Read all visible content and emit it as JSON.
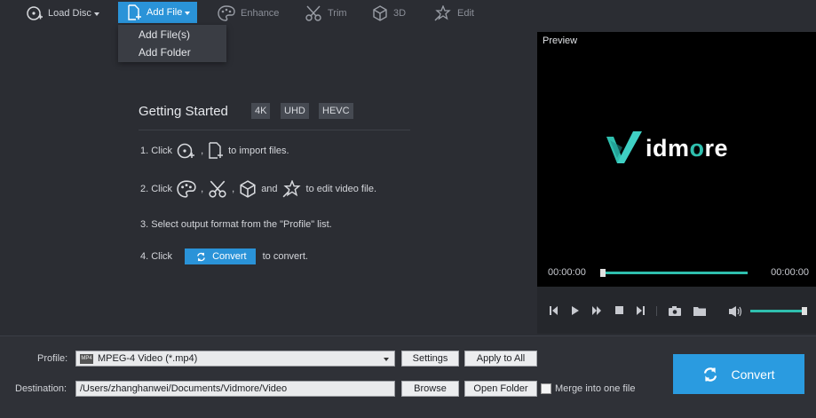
{
  "toolbar": {
    "load_disc": "Load Disc",
    "add_file": "Add File",
    "enhance": "Enhance",
    "trim": "Trim",
    "three_d": "3D",
    "edit": "Edit"
  },
  "dropdown": {
    "items": [
      "Add File(s)",
      "Add Folder"
    ]
  },
  "getting_started": {
    "title": "Getting Started",
    "badges": [
      "4K",
      "UHD",
      "HEVC"
    ],
    "step1_prefix": "1. Click",
    "step1_suffix": "to import files.",
    "step2_prefix": "2. Click",
    "step2_and": "and",
    "step2_suffix": "to edit video file.",
    "step3": "3. Select output format from the \"Profile\" list.",
    "step4_prefix": "4. Click",
    "step4_button": "Convert",
    "step4_suffix": "to convert."
  },
  "preview": {
    "title": "Preview",
    "logo_text_a": "idm",
    "logo_text_o": "o",
    "logo_text_b": "re",
    "time_current": "00:00:00",
    "time_total": "00:00:00",
    "progress": 0,
    "volume": 1.0
  },
  "bottom": {
    "profile_label": "Profile:",
    "profile_value": "MPEG-4 Video (*.mp4)",
    "profile_format_icon": "MP4",
    "settings": "Settings",
    "apply_all": "Apply to All",
    "destination_label": "Destination:",
    "destination_value": "/Users/zhanghanwei/Documents/Vidmore/Video",
    "browse": "Browse",
    "open_folder": "Open Folder",
    "merge_label": "Merge into one file",
    "convert": "Convert"
  },
  "colors": {
    "accent": "#2a93d8",
    "teal": "#2fbfae",
    "background": "#2b2d33"
  }
}
